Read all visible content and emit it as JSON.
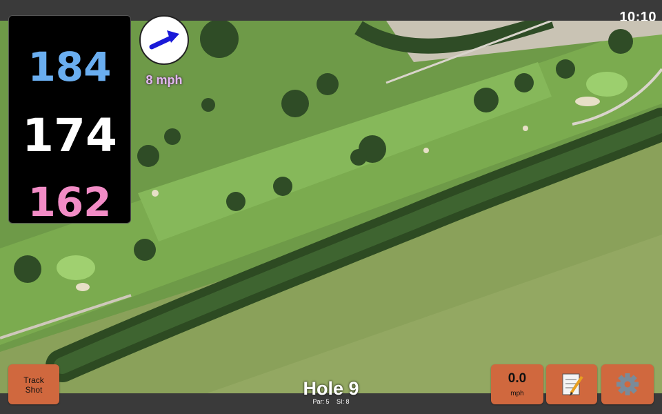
{
  "status": {
    "time": "10:10"
  },
  "distances": {
    "back": "184",
    "middle": "174",
    "front": "162"
  },
  "wind": {
    "label": "8 mph",
    "icon": "wind-arrow-icon"
  },
  "hole": {
    "title": "Hole 9",
    "par": "Par: 5",
    "stroke_index": "SI: 8"
  },
  "buttons": {
    "track_shot": {
      "line1": "Track",
      "line2": "Shot"
    },
    "speed": {
      "value": "0.0",
      "unit": "mph"
    },
    "notes": {
      "icon": "notepad-icon"
    },
    "settings": {
      "icon": "gear-icon"
    }
  },
  "colors": {
    "back": "#6aaef0",
    "middle": "#ffffff",
    "front": "#f28cc6",
    "button": "#d0683e",
    "wind_label": "#e2b7ef"
  }
}
